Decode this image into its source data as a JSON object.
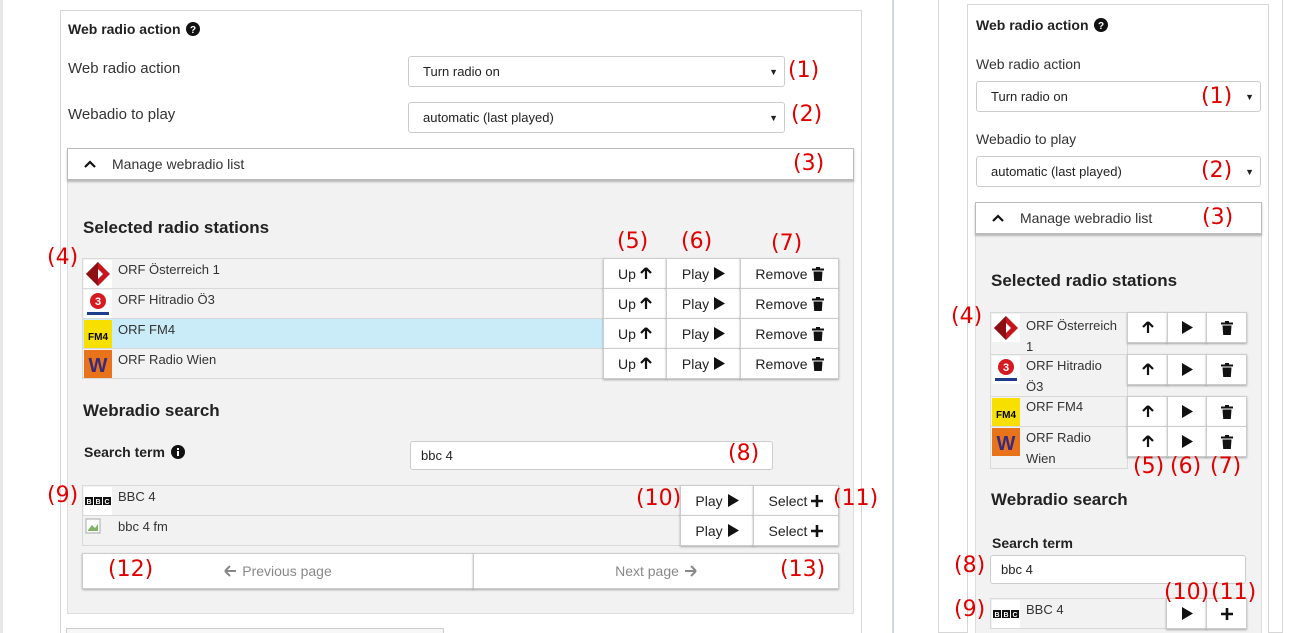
{
  "left": {
    "section_title": "Web radio action",
    "help_icon": "question-circle-icon",
    "action_label": "Web radio action",
    "action_value": "Turn radio on",
    "radio_label": "Webadio to play",
    "radio_value": "automatic (last played)",
    "manage_label": "Manage webradio list",
    "selected_title": "Selected radio stations",
    "stations": [
      {
        "name": "ORF Österreich 1",
        "logo": "orf-oe1-logo"
      },
      {
        "name": "ORF Hitradio Ö3",
        "logo": "orf-oe3-logo"
      },
      {
        "name": "ORF FM4",
        "logo": "orf-fm4-logo"
      },
      {
        "name": "ORF Radio Wien",
        "logo": "orf-radio-wien-logo"
      }
    ],
    "up_label": "Up",
    "play_label": "Play",
    "remove_label": "Remove",
    "search_title": "Webradio search",
    "search_term_label": "Search term",
    "search_value": "bbc 4",
    "results": [
      {
        "name": "BBC 4",
        "logo": "bbc-logo"
      },
      {
        "name": "bbc 4 fm",
        "logo": "broken-image-icon"
      }
    ],
    "select_label": "Select",
    "prev_label": "Previous page",
    "next_label": "Next page"
  },
  "right": {
    "section_title": "Web radio action",
    "action_label": "Web radio action",
    "action_value": "Turn radio on",
    "radio_label": "Webadio to play",
    "radio_value": "automatic (last played)",
    "manage_label": "Manage webradio list",
    "selected_title": "Selected radio stations",
    "stations": [
      {
        "line1": "ORF Österreich",
        "line2": "1"
      },
      {
        "line1": "ORF Hitradio",
        "line2": "Ö3"
      },
      {
        "line1": "ORF FM4",
        "line2": ""
      },
      {
        "line1": "ORF Radio",
        "line2": "Wien"
      }
    ],
    "search_title": "Webradio search",
    "search_term_label": "Search term",
    "search_value": "bbc 4",
    "result_name": "BBC 4"
  },
  "annotations": {
    "a1": "(1)",
    "a2": "(2)",
    "a3": "(3)",
    "a4": "(4)",
    "a5": "(5)",
    "a6": "(6)",
    "a7": "(7)",
    "a8": "(8)",
    "a9": "(9)",
    "a10": "(10)",
    "a11": "(11)",
    "a12": "(12)",
    "a13": "(13)"
  },
  "colors": {
    "annotation": "#e00000",
    "highlight_row": "#c9ecf8",
    "panel_grey": "#f2f2f2"
  }
}
